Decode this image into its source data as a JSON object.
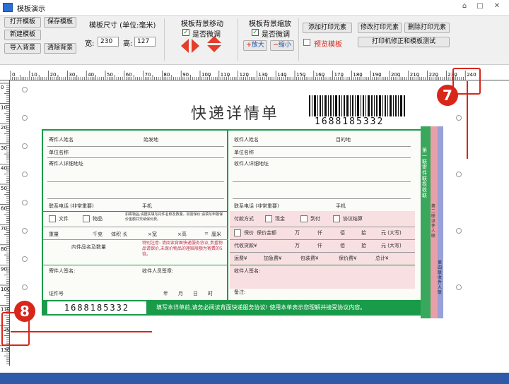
{
  "window": {
    "title": "模板演示",
    "controls": [
      "⌂",
      "□",
      "✕"
    ]
  },
  "toolbar": {
    "open_template": "打开模板",
    "save_template": "保存模板",
    "new_template": "新建模板",
    "import_background": "导入背景",
    "clear_background": "清除背景",
    "size_label": "模板尺寸 (单位:毫米)",
    "width_label": "宽:",
    "width_value": "230",
    "height_label": "高:",
    "height_value": "127",
    "move_label": "模板背景移动",
    "move_fine_label": "是否微调",
    "zoom_label": "模板背景缩放",
    "zoom_fine_label": "是否微调",
    "zoom_in": "放大",
    "zoom_out": "缩小",
    "add_element": "添加打印元素",
    "edit_element": "修改打印元素",
    "delete_element": "删除打印元素",
    "preview_template": "预览模板",
    "calibrate": "打印机修正和模板测试",
    "move_fine_checked": true,
    "zoom_fine_checked": true,
    "preview_checked": false
  },
  "ruler": {
    "h_labels": [
      "0",
      "10",
      "20",
      "30",
      "40",
      "50",
      "60",
      "70",
      "80",
      "90",
      "100",
      "110",
      "120",
      "130",
      "140",
      "150",
      "160",
      "170",
      "180",
      "190",
      "200",
      "210",
      "220",
      "230",
      "240"
    ],
    "v_labels": [
      "0",
      "10",
      "20",
      "30",
      "40",
      "50",
      "60",
      "70",
      "80",
      "90",
      "100",
      "110",
      "120",
      "130",
      "140"
    ]
  },
  "form": {
    "title": "快递详情单",
    "barcode_number": "1688185332",
    "bottom_number": "1688185332",
    "sender_name": "寄件人姓名",
    "origin": "始发地",
    "sender_company": "单位名称",
    "sender_address": "寄件人详细地址",
    "sender_phone": "联系电话 (非常重要)",
    "sender_mobile": "手机",
    "receiver_name": "收件人姓名",
    "destination": "目的地",
    "receiver_company": "单位名称",
    "receiver_address": "收件人详细地址",
    "receiver_phone": "联系电话 (非常重要)",
    "receiver_mobile": "手机",
    "doc": "文件",
    "item": "物品",
    "weight": "重量",
    "weight_unit": "千克",
    "volume": "体积 长",
    "width": "×宽",
    "height": "×高",
    "cm": "=",
    "cm_unit": "厘米",
    "contents": "内件品名及数量",
    "sender_sign": "寄件人签名:",
    "courier_sign": "收件人员签章:",
    "id_no": "证件号",
    "date": "年　　月　　日　　时",
    "payment": "付款方式",
    "cash": "现金",
    "collect": "到付",
    "contract": "协议结算",
    "insured": "保价",
    "insured_amount": "保价金额",
    "cod": "代收货款¥",
    "units": [
      "万",
      "仟",
      "佰",
      "拾",
      "元 (大写)"
    ],
    "freight": "运费¥",
    "extra": "加急费¥",
    "packing": "包装费¥",
    "insurance": "保价费¥",
    "total": "总计¥",
    "receiver_sign": "收件人签名:",
    "remark": "备注:",
    "notice": "特别注意: 请阅读背面快递服务协议,贵重物品请保价,未保价物品的理赔限额为寄费的5倍。",
    "item_notice": "如寄物品,请据实填写内件名称及数量。如需保价,请填写申报保价金额并交纳保价费。",
    "footer": "填写本详单前,请务必阅读背面快递服务协议! 使用本单表示您理解并接受协议内容。",
    "copy1": "第一联 寄件联 揽收联",
    "copy2": "第二联 派件人联",
    "copy3": "第四联 收件人联"
  },
  "annotations": {
    "marker_7": "7",
    "marker_8": "8"
  },
  "colors": {
    "accent_red": "#d8261a",
    "form_green": "#1a9b4a",
    "bottom_bar": "#2e5aa8"
  }
}
